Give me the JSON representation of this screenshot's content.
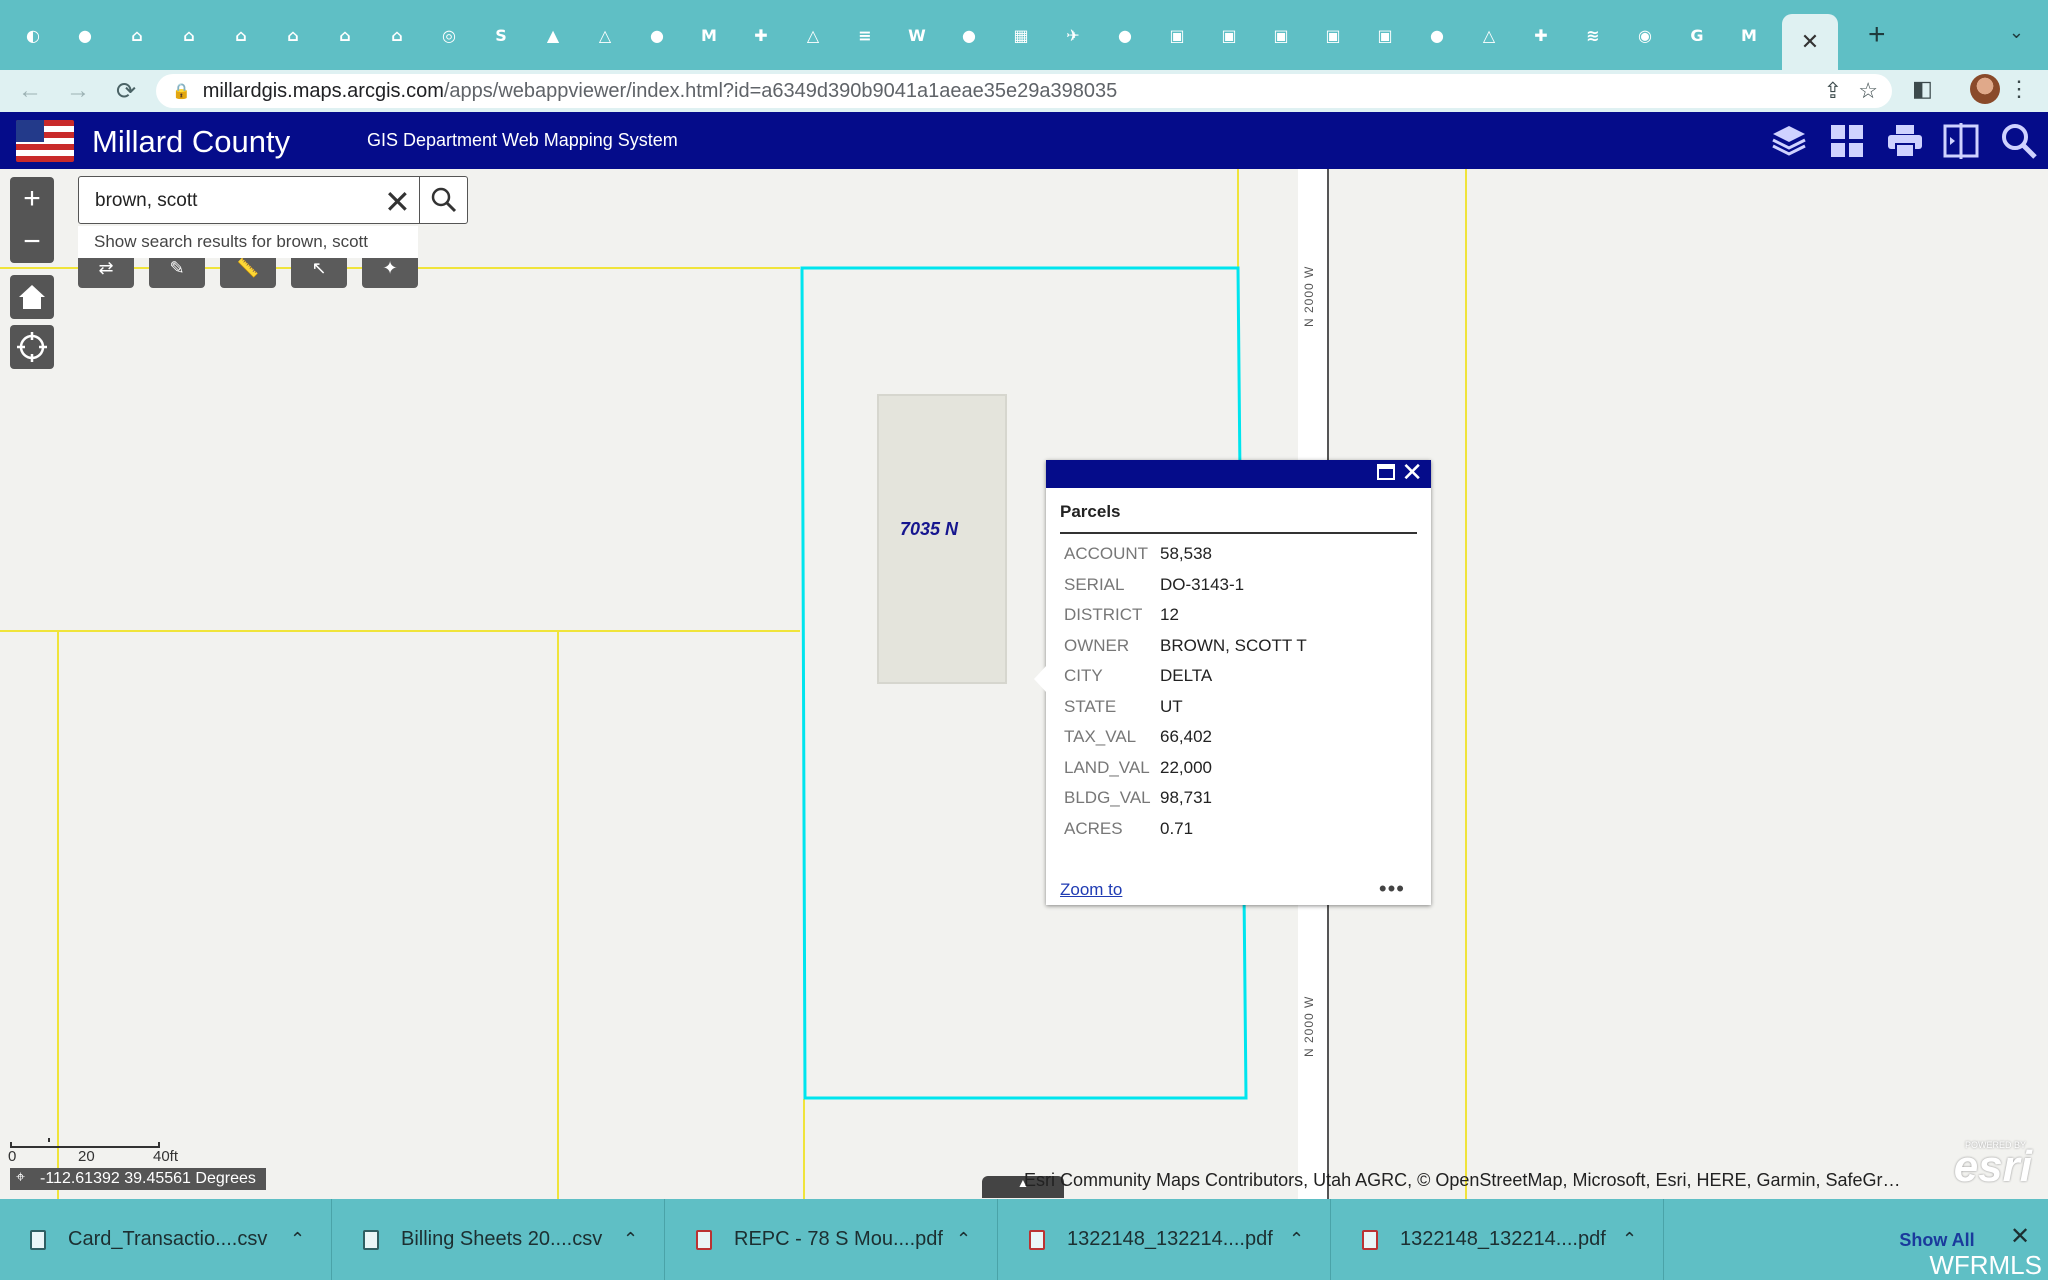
{
  "browser": {
    "tabs": [
      {
        "icon": "chrome-tab-icon-1",
        "glyph": "◐"
      },
      {
        "icon": "globe-tab-icon",
        "glyph": "●"
      },
      {
        "icon": "ure-tab-icon",
        "glyph": "⌂"
      },
      {
        "icon": "ure-tab-icon",
        "glyph": "⌂"
      },
      {
        "icon": "ure-tab-icon",
        "glyph": "⌂"
      },
      {
        "icon": "ure-tab-icon",
        "glyph": "⌂"
      },
      {
        "icon": "ure-tab-icon",
        "glyph": "⌂"
      },
      {
        "icon": "ure-tab-icon",
        "glyph": "⌂"
      },
      {
        "icon": "cloud-tab-icon",
        "glyph": "◎"
      },
      {
        "icon": "s-tab-icon",
        "glyph": "S"
      },
      {
        "icon": "drop-tab-icon",
        "glyph": "▲"
      },
      {
        "icon": "drive-tab-icon",
        "glyph": "△"
      },
      {
        "icon": "globe-tab-icon",
        "glyph": "●"
      },
      {
        "icon": "gmail-tab-icon",
        "glyph": "M"
      },
      {
        "icon": "sheets-tab-icon",
        "glyph": "✚"
      },
      {
        "icon": "drive-tab-icon",
        "glyph": "△"
      },
      {
        "icon": "docs-tab-icon",
        "glyph": "≡"
      },
      {
        "icon": "w-tab-icon",
        "glyph": "W"
      },
      {
        "icon": "globe-tab-icon",
        "glyph": "●"
      },
      {
        "icon": "calendar-tab-icon",
        "glyph": "▦"
      },
      {
        "icon": "bird-tab-icon",
        "glyph": "✈"
      },
      {
        "icon": "globe-tab-icon",
        "glyph": "●"
      },
      {
        "icon": "pdf-tab-icon",
        "glyph": "▣"
      },
      {
        "icon": "pdf-tab-icon",
        "glyph": "▣"
      },
      {
        "icon": "pdf-tab-icon",
        "glyph": "▣"
      },
      {
        "icon": "pdf-tab-icon",
        "glyph": "▣"
      },
      {
        "icon": "pdf-tab-icon",
        "glyph": "▣"
      },
      {
        "icon": "globe-tab-icon",
        "glyph": "●"
      },
      {
        "icon": "drive-tab-icon",
        "glyph": "△"
      },
      {
        "icon": "sheets-tab-icon",
        "glyph": "✚"
      },
      {
        "icon": "layers-tab-icon",
        "glyph": "≋"
      },
      {
        "icon": "chrome-tab-icon",
        "glyph": "◉"
      },
      {
        "icon": "google-tab-icon",
        "glyph": "G"
      },
      {
        "icon": "m-tab-icon",
        "glyph": "M"
      }
    ],
    "active_tab_close": "✕",
    "new_tab": "+",
    "url_host": "millardgis.maps.arcgis.com",
    "url_path": "/apps/webappviewer/index.html?id=a6349d390b9041a1aeae35e29a398035"
  },
  "app": {
    "title": "Millard County",
    "subtitle": "GIS Department Web Mapping System"
  },
  "search": {
    "value": "brown, scott",
    "suggestion": "Show search results for brown, scott"
  },
  "map": {
    "road_label_top": "N 2000 W",
    "road_label_bottom": "N 2000 W",
    "parcel_address": "7035 N",
    "scale_0": "0",
    "scale_20": "20",
    "scale_40": "40ft",
    "coordinates": "-112.61392 39.45561 Degrees",
    "attribution": "Esri Community Maps Contributors, Utah AGRC, © OpenStreetMap, Microsoft, Esri, HERE, Garmin, SafeGr…",
    "esri_logo": "esri",
    "esri_powered": "POWERED BY",
    "selection_color": "#00e5ee",
    "parcel_line_color": "#f0e43a"
  },
  "popup": {
    "title": "Parcels",
    "attributes": [
      {
        "key": "ACCOUNT",
        "value": "58,538"
      },
      {
        "key": "SERIAL",
        "value": "DO-3143-1"
      },
      {
        "key": "DISTRICT",
        "value": "12"
      },
      {
        "key": "OWNER",
        "value": "BROWN, SCOTT T"
      },
      {
        "key": "CITY",
        "value": "DELTA"
      },
      {
        "key": "STATE",
        "value": "UT"
      },
      {
        "key": "TAX_VAL",
        "value": "66,402"
      },
      {
        "key": "LAND_VAL",
        "value": "22,000"
      },
      {
        "key": "BLDG_VAL",
        "value": "98,731"
      },
      {
        "key": "ACRES",
        "value": "0.71"
      }
    ],
    "zoom_link": "Zoom to",
    "more": "•••"
  },
  "downloads": {
    "items": [
      {
        "name": "Card_Transactio....csv",
        "type": "csv"
      },
      {
        "name": "Billing Sheets 20....csv",
        "type": "csv"
      },
      {
        "name": "REPC - 78 S Mou....pdf",
        "type": "pdf"
      },
      {
        "name": "1322148_132214....pdf",
        "type": "pdf"
      },
      {
        "name": "1322148_132214....pdf",
        "type": "pdf"
      }
    ],
    "show_all": "Show All",
    "close": "✕"
  },
  "watermark": "WFRMLS"
}
